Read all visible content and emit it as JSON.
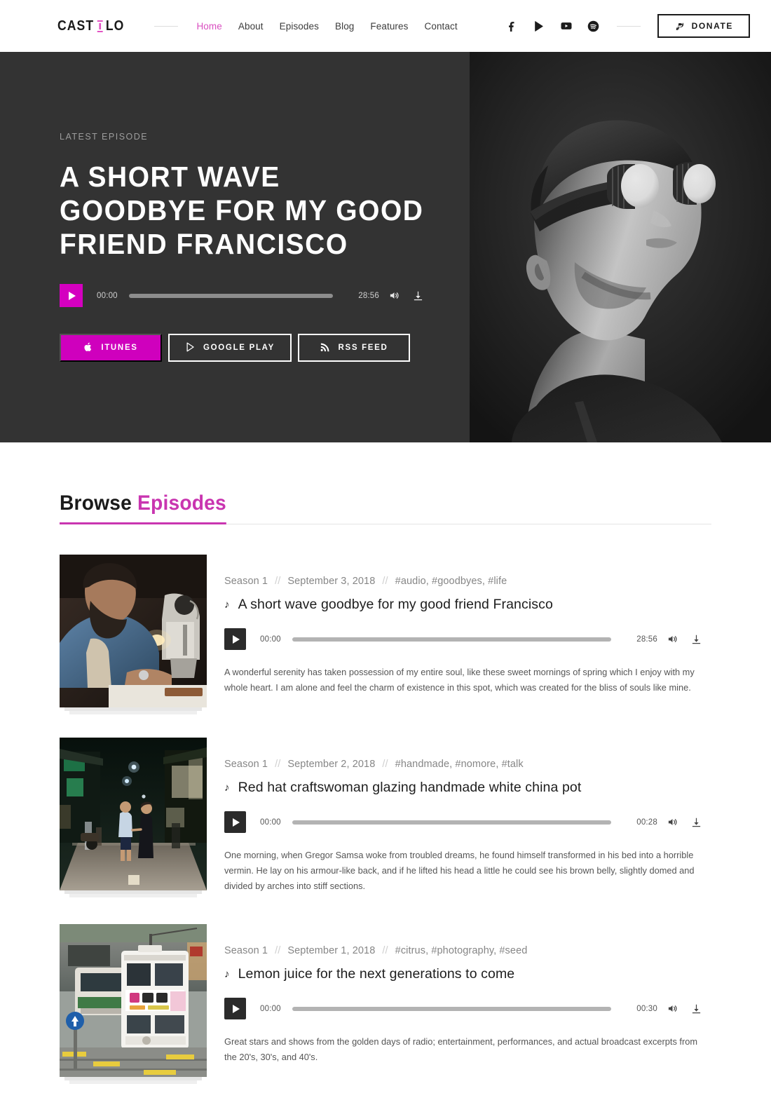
{
  "header": {
    "logo": {
      "text_left": "CAST",
      "text_right": "LO",
      "icon": "microphone-icon"
    },
    "nav": [
      {
        "label": "Home",
        "active": true
      },
      {
        "label": "About",
        "active": false
      },
      {
        "label": "Episodes",
        "active": false
      },
      {
        "label": "Blog",
        "active": false
      },
      {
        "label": "Features",
        "active": false
      },
      {
        "label": "Contact",
        "active": false
      }
    ],
    "social": [
      {
        "name": "facebook-icon",
        "label": "Facebook"
      },
      {
        "name": "google-play-icon",
        "label": "Google Play"
      },
      {
        "name": "youtube-icon",
        "label": "YouTube"
      },
      {
        "name": "spotify-icon",
        "label": "Spotify"
      }
    ],
    "donate": {
      "label": "DONATE",
      "icon": "paypal-icon"
    }
  },
  "hero": {
    "eyebrow": "LATEST EPISODE",
    "title": "A SHORT WAVE GOODBYE FOR MY GOOD FRIEND FRANCISCO",
    "image_alt": "Black and white portrait of a man wearing reflective round goggles",
    "player": {
      "current_time": "00:00",
      "duration": "28:56",
      "progress_percent": 0,
      "play_icon": "play-icon",
      "volume_icon": "volume-icon",
      "download_icon": "download-icon"
    },
    "subscribe": [
      {
        "label": "ITUNES",
        "icon": "apple-icon",
        "style": "filled"
      },
      {
        "label": "GOOGLE PLAY",
        "icon": "google-play-icon",
        "style": "outline"
      },
      {
        "label": "RSS FEED",
        "icon": "rss-icon",
        "style": "outline"
      }
    ]
  },
  "browse": {
    "heading_first": "Browse",
    "heading_accent": "Episodes",
    "episodes": [
      {
        "season": "Season 1",
        "date": "September 3, 2018",
        "tags": "#audio, #goodbyes, #life",
        "title": "A short wave goodbye for my good friend Francisco",
        "image_alt": "Bearded man working at an industrial sewing machine",
        "player": {
          "current_time": "00:00",
          "duration": "28:56",
          "progress_percent": 0
        },
        "description": "A wonderful serenity has taken possession of my entire soul, like these sweet mornings of spring which I enjoy with my whole heart. I am alone and feel the charm of existence in this spot, which was created for the bliss of souls like mine."
      },
      {
        "season": "Season 1",
        "date": "September 2, 2018",
        "tags": "#handmade, #nomore, #talk",
        "title": "Red hat craftswoman glazing handmade white china pot",
        "image_alt": "Couple walking hand in hand through a night market street",
        "player": {
          "current_time": "00:00",
          "duration": "00:28",
          "progress_percent": 0
        },
        "description": "One morning, when Gregor Samsa woke from troubled dreams, he found himself transformed in his bed into a horrible vermin. He lay on his armour-like back, and if he lifted his head a little he could see his brown belly, slightly domed and divided by arches into stiff sections."
      },
      {
        "season": "Season 1",
        "date": "September 1, 2018",
        "tags": "#citrus, #photography, #seed",
        "title": "Lemon juice for the next generations to come",
        "image_alt": "White double decker tram on a city street",
        "player": {
          "current_time": "00:00",
          "duration": "00:30",
          "progress_percent": 0
        },
        "description": "Great stars and shows from the golden days of radio; entertainment, performances, and actual broadcast excerpts from the 20's, 30's, and 40's."
      }
    ],
    "separator": "//"
  },
  "colors": {
    "accent": "#c935b0",
    "accent_bright": "#d400c0",
    "hero_bg": "#333333",
    "text_dark": "#1b1b1b",
    "text_muted": "#868686"
  }
}
